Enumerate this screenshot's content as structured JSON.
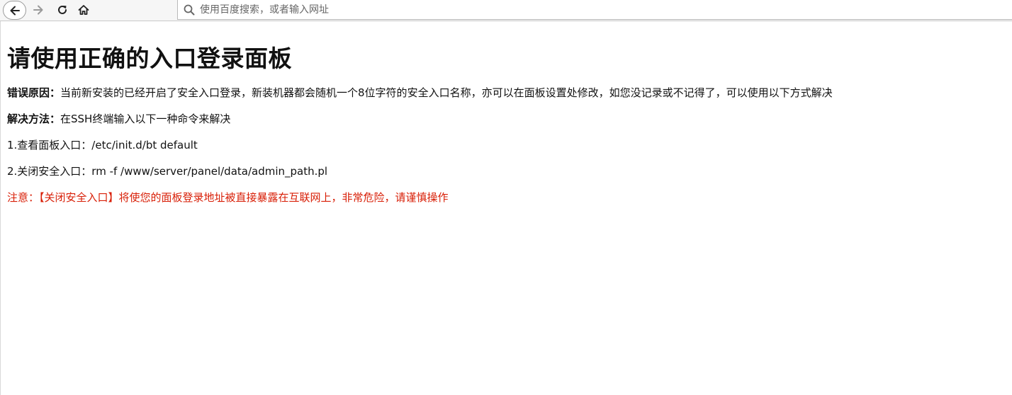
{
  "browser": {
    "url_placeholder": "使用百度搜索，或者输入网址"
  },
  "page": {
    "title": "请使用正确的入口登录面板",
    "error_reason_label": "错误原因：",
    "error_reason_text": "当前新安装的已经开启了安全入口登录，新装机器都会随机一个8位字符的安全入口名称，亦可以在面板设置处修改，如您没记录或不记得了，可以使用以下方式解决",
    "solution_label": "解决方法：",
    "solution_text": "在SSH终端输入以下一种命令来解决",
    "step1": "1.查看面板入口：/etc/init.d/bt default",
    "step2": "2.关闭安全入口：rm -f /www/server/panel/data/admin_path.pl",
    "warning": "注意：【关闭安全入口】将使您的面板登录地址被直接暴露在互联网上，非常危险，请谨慎操作"
  },
  "colors": {
    "warning_red": "#d81e06"
  },
  "icons": {
    "back": "arrow-left-icon",
    "forward": "arrow-right-icon",
    "reload": "reload-icon",
    "home": "home-icon",
    "search": "search-icon"
  }
}
